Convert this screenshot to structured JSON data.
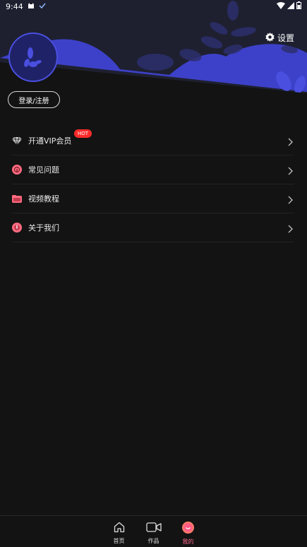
{
  "status_bar": {
    "time": "9:44"
  },
  "profile": {
    "settings_label": "设置",
    "login_label": "登录/注册"
  },
  "menu": {
    "items": [
      {
        "label": "开通VIP会员",
        "icon": "diamond-icon",
        "badge": "HOT"
      },
      {
        "label": "常见问题",
        "icon": "question-icon"
      },
      {
        "label": "视频教程",
        "icon": "video-folder-icon"
      },
      {
        "label": "关于我们",
        "icon": "info-icon"
      }
    ]
  },
  "tabbar": {
    "tabs": [
      {
        "label": "首页",
        "icon": "home-icon"
      },
      {
        "label": "作品",
        "icon": "video-camera-icon"
      },
      {
        "label": "我的",
        "icon": "profile-smile-icon",
        "active": true
      }
    ]
  },
  "colors": {
    "accent": "#4a4fe0",
    "background": "#131313",
    "hot_badge": "#ff2b2b",
    "active_tab": "#ff6a8e"
  }
}
